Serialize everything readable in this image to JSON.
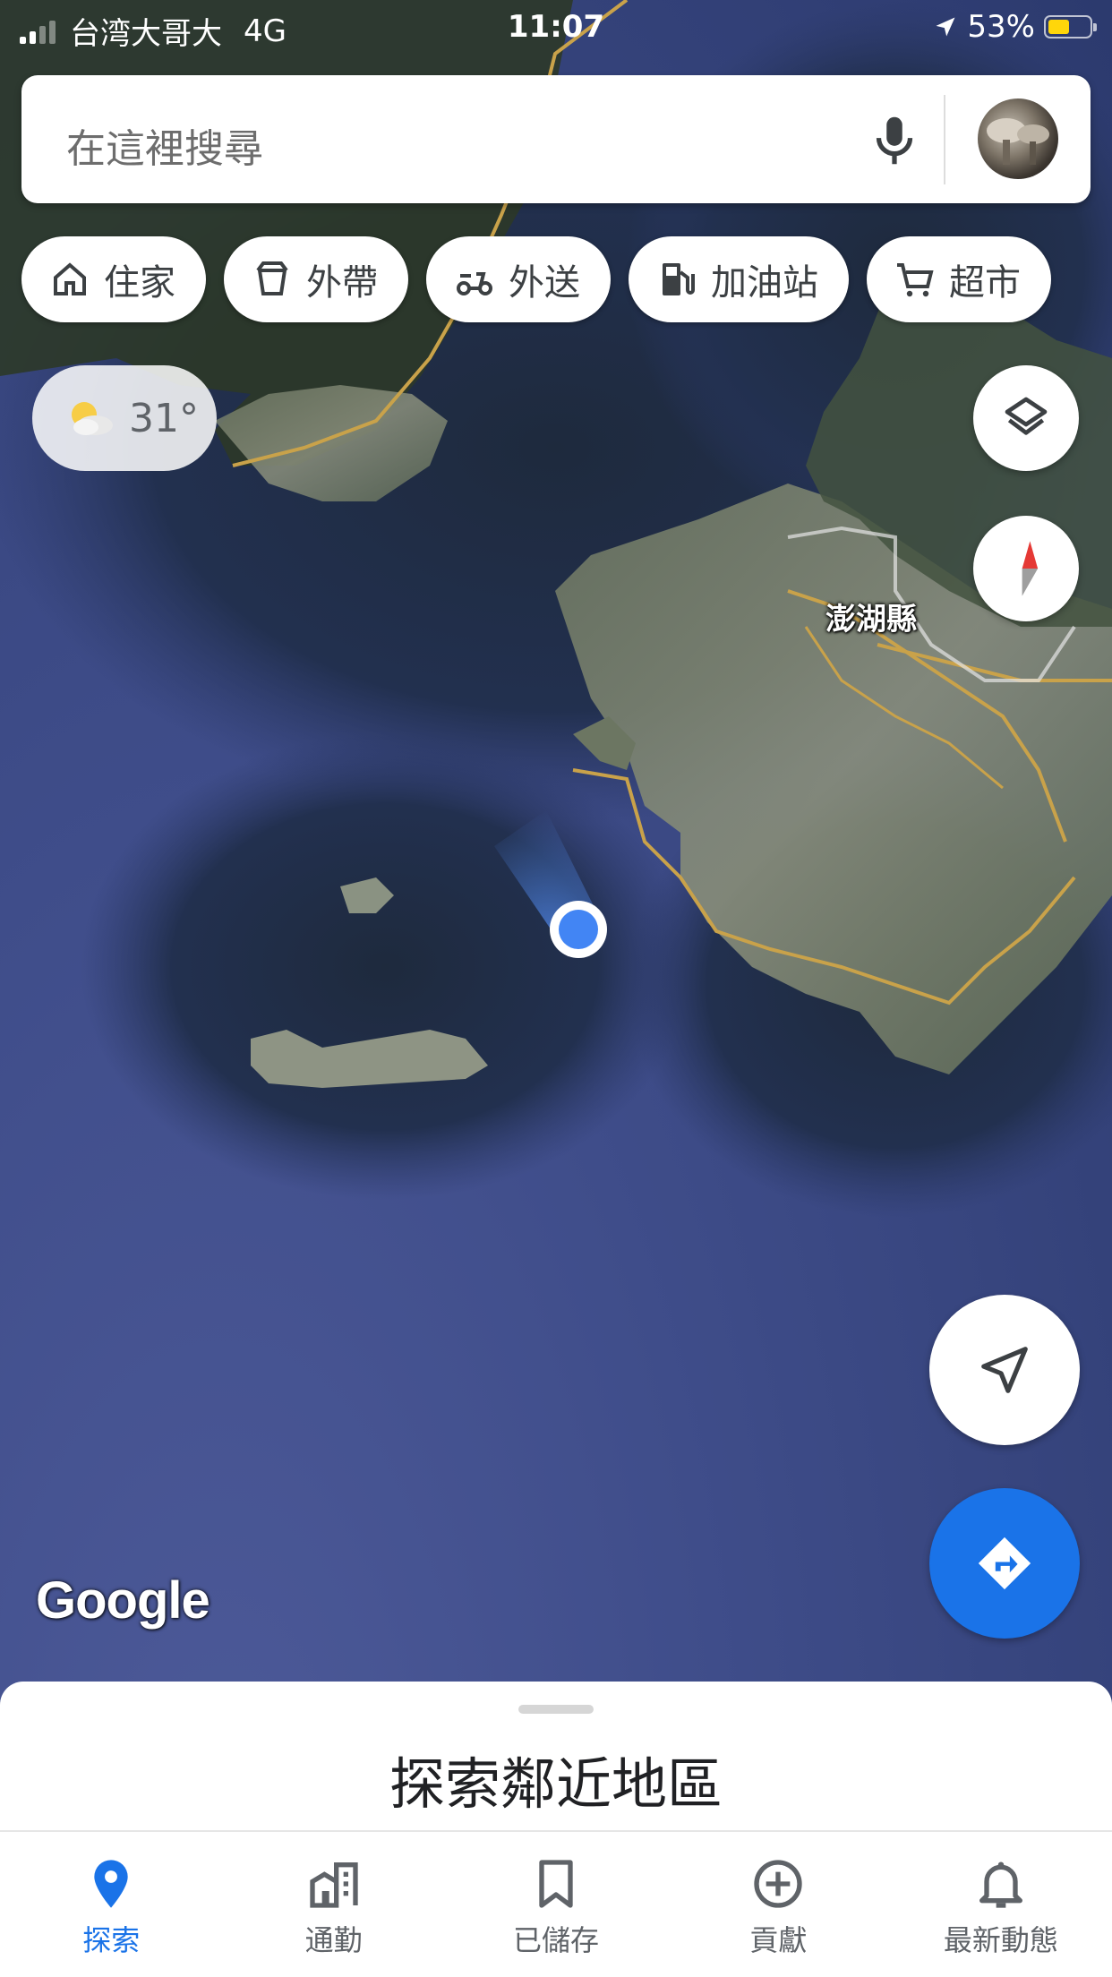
{
  "status_bar": {
    "carrier": "台湾大哥大",
    "network": "4G",
    "time": "11:07",
    "battery": "53%",
    "battery_level": 0.53
  },
  "search": {
    "placeholder": "在這裡搜尋",
    "mic_icon": "mic-icon",
    "avatar_icon": "profile-avatar"
  },
  "chips": [
    {
      "label": "住家",
      "icon": "home-icon"
    },
    {
      "label": "外帶",
      "icon": "takeout-icon"
    },
    {
      "label": "外送",
      "icon": "delivery-icon"
    },
    {
      "label": "加油站",
      "icon": "gas-station-icon"
    },
    {
      "label": "超市",
      "icon": "cart-icon"
    }
  ],
  "weather": {
    "temp": "31°",
    "icon": "partly-cloudy-icon"
  },
  "map": {
    "place_label": "澎湖縣",
    "watermark": "Google",
    "layers_icon": "layers-icon",
    "compass_icon": "compass-icon",
    "locate_icon": "my-location-icon",
    "directions_icon": "directions-icon",
    "colors": {
      "directions_button": "#1a73e8",
      "location_dot": "#4285f4",
      "compass_red": "#e53935"
    }
  },
  "sheet": {
    "title": "探索鄰近地區"
  },
  "nav": [
    {
      "label": "探索",
      "icon": "explore-pin-icon",
      "active": true
    },
    {
      "label": "通勤",
      "icon": "commute-buildings-icon",
      "active": false
    },
    {
      "label": "已儲存",
      "icon": "bookmark-icon",
      "active": false
    },
    {
      "label": "貢獻",
      "icon": "add-circle-icon",
      "active": false
    },
    {
      "label": "最新動態",
      "icon": "bell-icon",
      "active": false
    }
  ],
  "colors": {
    "accent": "#1a73e8",
    "sea": "#2d3f75"
  }
}
